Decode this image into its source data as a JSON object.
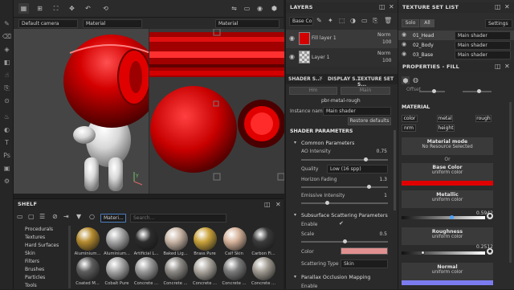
{
  "top": {
    "camera": "Default camera",
    "material_mode": "Material",
    "material_mode_2d": "Material",
    "zoom_y": "Y"
  },
  "layers": {
    "title": "LAYERS",
    "channel": "Base Co",
    "items": [
      {
        "name": "Fill layer 1",
        "blend": "Norm",
        "opacity": "100"
      },
      {
        "name": "Layer 1",
        "blend": "Norm",
        "opacity": "100"
      }
    ]
  },
  "texture_set_list": {
    "title": "TEXTURE SET LIST",
    "solo": "Solo",
    "all": "All",
    "settings": "Settings",
    "items": [
      {
        "name": "01_Head",
        "shader": "Main shader"
      },
      {
        "name": "02_Body",
        "shader": "Main shader"
      },
      {
        "name": "03_Base",
        "shader": "Main shader"
      }
    ]
  },
  "shader_panel": {
    "tabs": [
      "SHADER S...",
      "DISPLAY S...",
      "TEXTURE SET S..."
    ],
    "top_buttons": [
      "Hm",
      "Main"
    ],
    "shader_name": "pbr-metal-rough",
    "instance_label": "Instance name",
    "instance_value": "Main shader",
    "restore": "Restore defaults",
    "params_title": "SHADER PARAMETERS",
    "common_title": "Common Parameters",
    "ao_label": "AO Intensity",
    "ao_value": "0.75",
    "quality_label": "Quality",
    "quality_value": "Low (16 spp)",
    "horizon_label": "Horizon Fading",
    "horizon_value": "1.3",
    "emissive_label": "Emissive Intensity",
    "emissive_value": "1",
    "sss_title": "Subsurface Scattering Parameters",
    "enable_label": "Enable",
    "scale_label": "Scale",
    "scale_value": "0.5",
    "color_label": "Color",
    "sss_color": "#e09090",
    "type_label": "Scattering Type",
    "type_value": "Skin",
    "pom_title": "Parallax Occlusion Mapping",
    "pom_enable": "Enable"
  },
  "properties": {
    "title": "PROPERTIES - FILL",
    "offset_label": "Offset",
    "material_title": "MATERIAL",
    "channels": [
      "color",
      "metal",
      "rough",
      "nrm",
      "height"
    ],
    "mode_title": "Material mode",
    "mode_value": "No Resource Selected",
    "or": "Or",
    "base_color": {
      "title": "Base Color",
      "sub": "uniform color",
      "swatch": "#e00000"
    },
    "metallic": {
      "title": "Metallic",
      "sub": "uniform color",
      "value": "0.5942",
      "level": 0.5942
    },
    "roughness": {
      "title": "Roughness",
      "sub": "uniform color",
      "value": "0.2512",
      "level": 0.2512
    },
    "normal": {
      "title": "Normal",
      "sub": "uniform color",
      "swatch": "#7b7bef"
    }
  },
  "shelf": {
    "title": "SHELF",
    "filter": "Materi...",
    "search_placeholder": "Search...",
    "categories": [
      "Procedurals",
      "Textures",
      "Hard Surfaces",
      "Skin",
      "Filters",
      "Brushes",
      "Particles",
      "Tools"
    ],
    "materials": [
      {
        "name": "Aluminium...",
        "color": "#b58b2f"
      },
      {
        "name": "Aluminium...",
        "color": "#a7a7a7"
      },
      {
        "name": "Artificial L...",
        "color": "#2c2c2c"
      },
      {
        "name": "Baked Lig...",
        "color": "#c9b6a6"
      },
      {
        "name": "Brass Pure",
        "color": "#c9a23b"
      },
      {
        "name": "Calf Skin",
        "color": "#d6b39b"
      },
      {
        "name": "Carbon Fi...",
        "color": "#3a3a3a"
      },
      {
        "name": "Coated M...",
        "color": "#5d5d5d"
      },
      {
        "name": "Cobalt Pure",
        "color": "#a8a8a8"
      },
      {
        "name": "Concrete ...",
        "color": "#9a9a9a"
      },
      {
        "name": "Concrete ...",
        "color": "#8d8a86"
      },
      {
        "name": "Concrete ...",
        "color": "#aca79f"
      },
      {
        "name": "Concrete ...",
        "color": "#7b7b7b"
      },
      {
        "name": "Concrete ...",
        "color": "#a19b92"
      }
    ]
  }
}
